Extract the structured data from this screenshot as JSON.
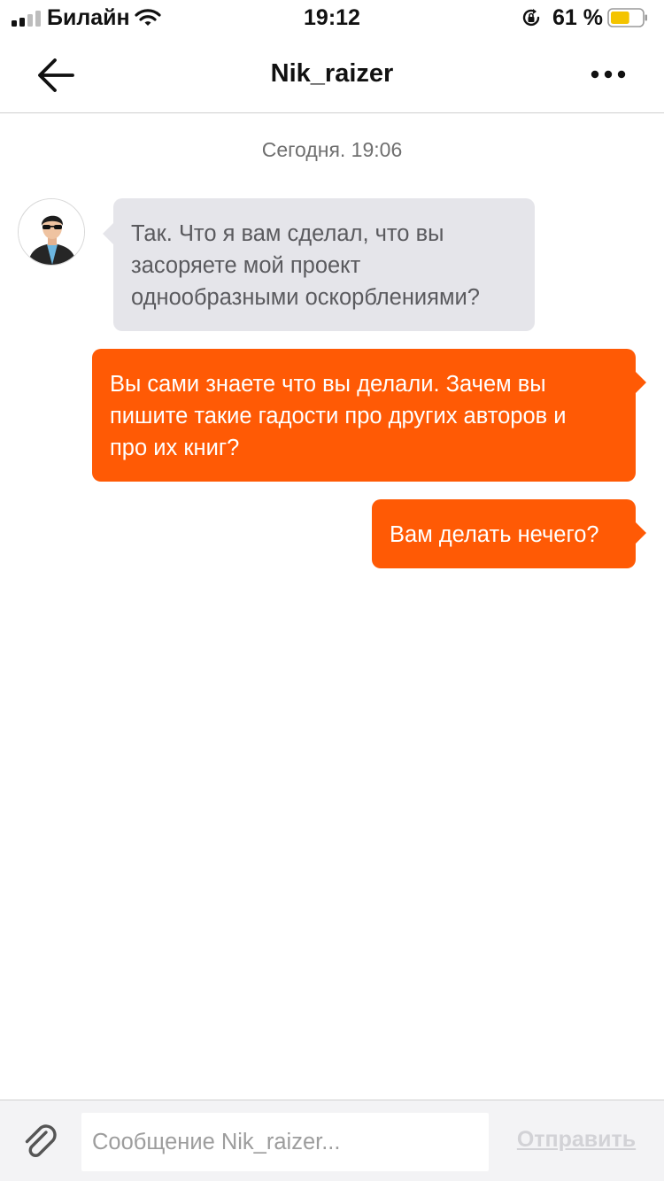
{
  "status_bar": {
    "carrier": "Билайн",
    "time": "19:12",
    "battery_percent": "61 %",
    "battery_level": 0.61,
    "battery_color": "#f4c400",
    "icons": [
      "signal-icon",
      "wifi-icon",
      "rotation-lock-icon",
      "battery-icon"
    ]
  },
  "header": {
    "title": "Nik_raizer",
    "back_icon": "arrow-left-icon",
    "more_icon": "ellipsis-icon"
  },
  "chat": {
    "date_separator": "Сегодня. 19:06",
    "messages": [
      {
        "direction": "incoming",
        "lines": [
          "Так. Что я вам сделал, что вы",
          "засоряете мой проект",
          "однообразными оскорблениями?"
        ]
      },
      {
        "direction": "outgoing",
        "lines": [
          "Вы сами знаете что вы делали. Зачем вы",
          "пишите такие гадости про других авторов и",
          "про их книг?"
        ]
      },
      {
        "direction": "outgoing",
        "lines": [
          "Вам делать нечего?"
        ]
      }
    ]
  },
  "composer": {
    "placeholder": "Сообщение Nik_raizer...",
    "value": "",
    "send_label": "Отправить",
    "attach_icon": "paperclip-icon"
  },
  "colors": {
    "accent": "#ff5a05",
    "incoming_bubble": "#e5e5ea",
    "incoming_text": "#5a5a5e",
    "send_disabled": "#d2d2d6"
  }
}
